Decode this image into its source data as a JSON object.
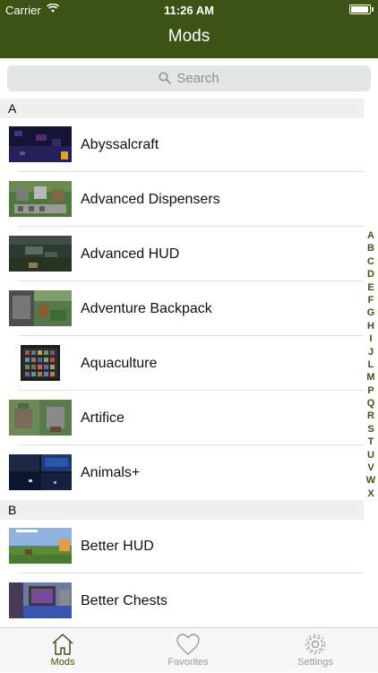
{
  "status_bar": {
    "carrier": "Carrier",
    "time": "11:26 AM",
    "battery_level": 0.95
  },
  "nav": {
    "title": "Mods"
  },
  "search": {
    "placeholder": "Search"
  },
  "sections": [
    {
      "letter": "A",
      "items": [
        {
          "label": "Abyssalcraft"
        },
        {
          "label": "Advanced Dispensers"
        },
        {
          "label": "Advanced HUD"
        },
        {
          "label": "Adventure Backpack"
        },
        {
          "label": "Aquaculture"
        },
        {
          "label": "Artifice"
        },
        {
          "label": "Animals+"
        }
      ]
    },
    {
      "letter": "B",
      "items": [
        {
          "label": "Better HUD"
        },
        {
          "label": "Better Chests"
        }
      ]
    }
  ],
  "index_letters": [
    "A",
    "B",
    "C",
    "D",
    "E",
    "F",
    "G",
    "H",
    "I",
    "J",
    "L",
    "M",
    "P",
    "Q",
    "R",
    "S",
    "T",
    "U",
    "V",
    "W",
    "X"
  ],
  "tabs": [
    {
      "label": "Mods",
      "icon": "house-icon",
      "selected": true
    },
    {
      "label": "Favorites",
      "icon": "heart-icon",
      "selected": false
    },
    {
      "label": "Settings",
      "icon": "gear-icon",
      "selected": false
    }
  ],
  "colors": {
    "accent": "#3d5316",
    "tab_inactive": "#9a9a9a",
    "search_bg": "#e4e5e7"
  }
}
